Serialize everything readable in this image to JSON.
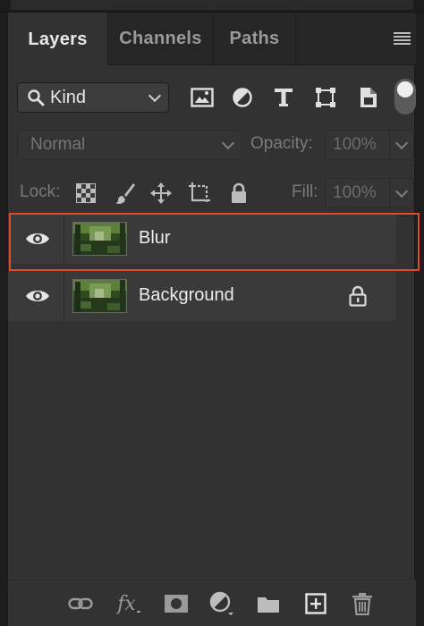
{
  "tabs": [
    {
      "label": "Layers",
      "active": true
    },
    {
      "label": "Channels",
      "active": false
    },
    {
      "label": "Paths",
      "active": false
    }
  ],
  "filter": {
    "kind_label": "Kind",
    "icons": [
      "pixel-filter-icon",
      "adjustment-filter-icon",
      "type-filter-icon",
      "shape-filter-icon",
      "smart-object-filter-icon"
    ],
    "toggle": "on"
  },
  "blend": {
    "mode": "Normal",
    "opacity_label": "Opacity:",
    "opacity_value": "100%"
  },
  "lock": {
    "label": "Lock:",
    "fill_label": "Fill:",
    "fill_value": "100%"
  },
  "layers": [
    {
      "name": "Blur",
      "visible": true,
      "selected": true,
      "locked": false
    },
    {
      "name": "Background",
      "visible": true,
      "selected": false,
      "locked": true
    }
  ],
  "bottom_icons": [
    "link-layers-icon",
    "fx-icon",
    "add-mask-icon",
    "adjustment-layer-icon",
    "new-group-icon",
    "new-layer-icon",
    "trash-icon"
  ],
  "colors": {
    "panel_bg": "#323232",
    "selection_outline": "#e04a2a"
  }
}
